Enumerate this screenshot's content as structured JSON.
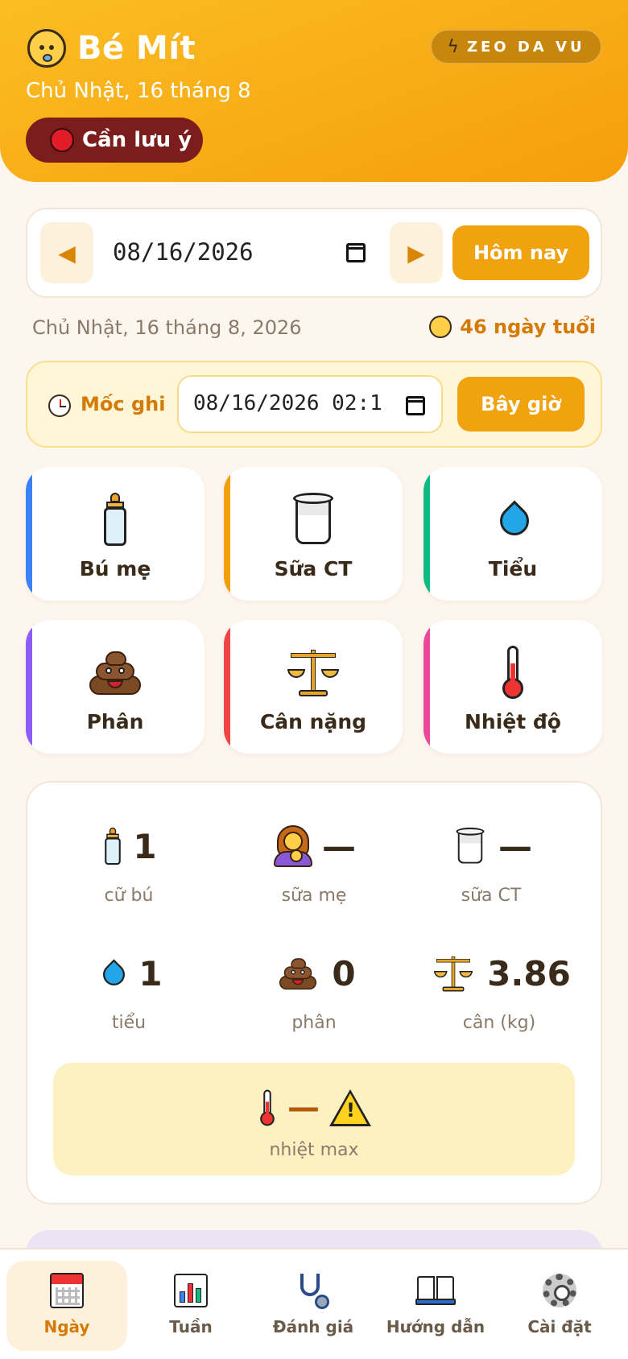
{
  "header": {
    "app_name": "Bé Mít",
    "date": "Chủ Nhật, 16 tháng 8",
    "alert_label": "Cần lưu ý",
    "mode_label": "ZEO DA VU",
    "brand_color": "#f59e0b",
    "alert_color": "#7b1d1d"
  },
  "date_bar": {
    "prev_icon": "triangle-left-icon",
    "date_value": "08/16/2026",
    "next_icon": "triangle-right-icon",
    "today_label": "Hôm nay"
  },
  "info": {
    "full_date": "Chủ Nhật, 16 tháng 8, 2026",
    "age": "46 ngày tuổi"
  },
  "time_picker": {
    "label": "Mốc ghi",
    "value": "08/16/2026 02:1",
    "now_label": "Bây giờ"
  },
  "actions": [
    {
      "label": "Bú mẹ",
      "icon": "baby-bottle-icon",
      "color": "#3b82f6"
    },
    {
      "label": "Sữa CT",
      "icon": "glass-of-milk-icon",
      "color": "#f59e0b"
    },
    {
      "label": "Tiểu",
      "icon": "droplet-icon",
      "color": "#10b981"
    },
    {
      "label": "Phân",
      "icon": "poo-icon",
      "color": "#8b5cf6"
    },
    {
      "label": "Cân nặng",
      "icon": "balance-scale-icon",
      "color": "#ef4444"
    },
    {
      "label": "Nhiệt độ",
      "icon": "thermometer-icon",
      "color": "#ec4899"
    }
  ],
  "summary": {
    "feeds": {
      "value": "1",
      "label": "cữ bú"
    },
    "breast_milk": {
      "value": "—",
      "label": "sữa mẹ"
    },
    "formula": {
      "value": "—",
      "label": "sữa CT"
    },
    "pee": {
      "value": "1",
      "label": "tiểu"
    },
    "poop": {
      "value": "0",
      "label": "phân"
    },
    "weight": {
      "value": "3.86",
      "label": "cân (kg)"
    },
    "temp": {
      "value": "—",
      "label": "nhiệt max"
    }
  },
  "bottom_nav": [
    {
      "label": "Ngày",
      "icon": "calendar-icon",
      "active": true
    },
    {
      "label": "Tuần",
      "icon": "bar-chart-icon",
      "active": false
    },
    {
      "label": "Đánh giá",
      "icon": "stethoscope-icon",
      "active": false
    },
    {
      "label": "Hướng dẫn",
      "icon": "open-book-icon",
      "active": false
    },
    {
      "label": "Cài đặt",
      "icon": "gear-icon",
      "active": false
    }
  ]
}
